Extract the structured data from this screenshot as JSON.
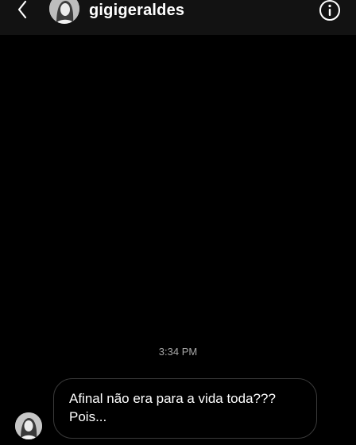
{
  "header": {
    "username": "gigigeraldes",
    "back_icon": "chevron-left-icon",
    "info_icon": "info-icon",
    "background": "#121212"
  },
  "thread": {
    "timestamp": "3:34 PM",
    "messages": [
      {
        "direction": "incoming",
        "lines": [
          "Afinal não era para a vida toda???",
          "Pois..."
        ]
      }
    ]
  },
  "colors": {
    "background": "#000000",
    "text": "#ffffff",
    "timestamp": "#a8a8a8",
    "bubble_border": "#3a3a3a"
  }
}
